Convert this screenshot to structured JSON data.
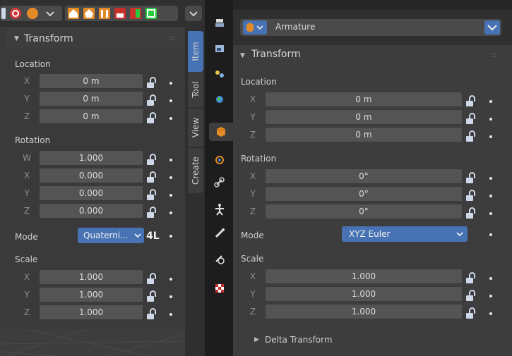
{
  "colors": {
    "accent": "#4772b3",
    "field": "#545454",
    "panel": "#3d3d3d",
    "header": "#303030",
    "tabs_bg": "#1d1d1d"
  },
  "left_panel": {
    "title": "Transform",
    "location": {
      "label": "Location",
      "axes": [
        "X",
        "Y",
        "Z"
      ],
      "values": [
        "0 m",
        "0 m",
        "0 m"
      ]
    },
    "rotation": {
      "label": "Rotation",
      "axes": [
        "W",
        "X",
        "Y",
        "Z"
      ],
      "values": [
        "1.000",
        "0.000",
        "0.000",
        "0.000"
      ]
    },
    "mode": {
      "label": "Mode",
      "value": "Quaterni...",
      "lock_text": "4L"
    },
    "scale": {
      "label": "Scale",
      "axes": [
        "X",
        "Y",
        "Z"
      ],
      "values": [
        "1.000",
        "1.000",
        "1.000"
      ]
    }
  },
  "sidebar_tabs": [
    "Item",
    "Tool",
    "View",
    "Create"
  ],
  "properties_tabs": [
    "tool-icon",
    "render-icon",
    "output-icon",
    "view-layer-icon",
    "scene-icon",
    "world-icon",
    "object-icon",
    "modifiers-icon",
    "constraints-icon",
    "object-data-icon",
    "bone-icon",
    "bone-constraints-icon",
    "texture-icon"
  ],
  "right_panel": {
    "object_name": "Armature",
    "title": "Transform",
    "location": {
      "label": "Location",
      "axes": [
        "X",
        "Y",
        "Z"
      ],
      "values": [
        "0 m",
        "0 m",
        "0 m"
      ]
    },
    "rotation": {
      "label": "Rotation",
      "axes": [
        "X",
        "Y",
        "Z"
      ],
      "values": [
        "0°",
        "0°",
        "0°"
      ]
    },
    "mode": {
      "label": "Mode",
      "value": "XYZ Euler"
    },
    "scale": {
      "label": "Scale",
      "axes": [
        "X",
        "Y",
        "Z"
      ],
      "values": [
        "1.000",
        "1.000",
        "1.000"
      ]
    },
    "delta": "Delta Transform"
  }
}
